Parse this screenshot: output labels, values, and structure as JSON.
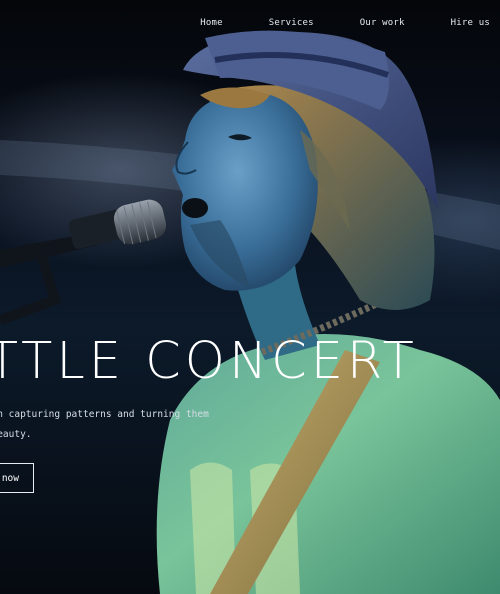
{
  "nav": {
    "items": [
      {
        "label": "Home"
      },
      {
        "label": "Services"
      },
      {
        "label": "Our work"
      },
      {
        "label": "Hire us"
      }
    ]
  },
  "hero": {
    "title": "ATTLE CONCERT",
    "subtitle_line1": "cialises in capturing patterns and turning them",
    "subtitle_line2": "ethereal beauty.",
    "cta_label": "s now"
  },
  "colors": {
    "text": "#ffffff",
    "background": "#05070a",
    "stage_light": "#1e6f9a",
    "shirt": "#8bd0a0",
    "hat": "#4a5a86"
  }
}
